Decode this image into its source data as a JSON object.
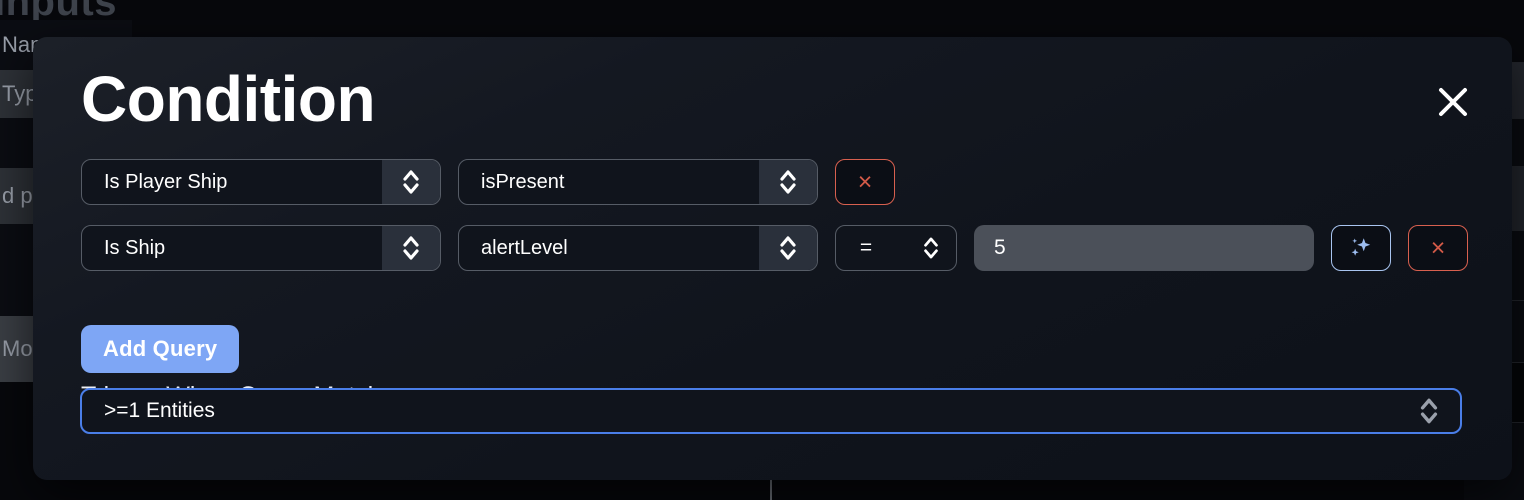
{
  "background": {
    "title": "Inputs",
    "rows": [
      {
        "text": "Name",
        "style": "dark"
      },
      {
        "text": "Type T",
        "style": "light"
      },
      {
        "text": "",
        "style": "dark"
      },
      {
        "text": "d pr",
        "style": "light"
      },
      {
        "text": "",
        "style": "dark"
      },
      {
        "text": "Mo",
        "style": "mid"
      }
    ]
  },
  "modal": {
    "title": "Condition",
    "close_icon": "close-icon",
    "query_rows": [
      {
        "entity": "Is Player Ship",
        "property": "isPresent",
        "has_operator": false,
        "operator": "",
        "value": "",
        "has_value": false,
        "has_ai_button": false,
        "delete_label": "×"
      },
      {
        "entity": "Is Ship",
        "property": "alertLevel",
        "has_operator": true,
        "operator": "=",
        "value": "5",
        "value_placeholder": "",
        "has_value": true,
        "has_ai_button": true,
        "ai_icon": "sparkles-icon",
        "delete_label": "×"
      }
    ],
    "add_query_label": "Add Query",
    "trigger_label": "Trigger When Query Matches:",
    "trigger_value": ">=1 Entities"
  },
  "colors": {
    "accent_blue": "#7ea6f5",
    "focus_ring": "#4a7ee8",
    "danger_red": "#d35a48",
    "ai_border": "#a9c5f0",
    "modal_bg": "#141821",
    "input_bg": "#4b5059",
    "select_border": "#565c66",
    "stepper_bg": "#2a303b"
  }
}
